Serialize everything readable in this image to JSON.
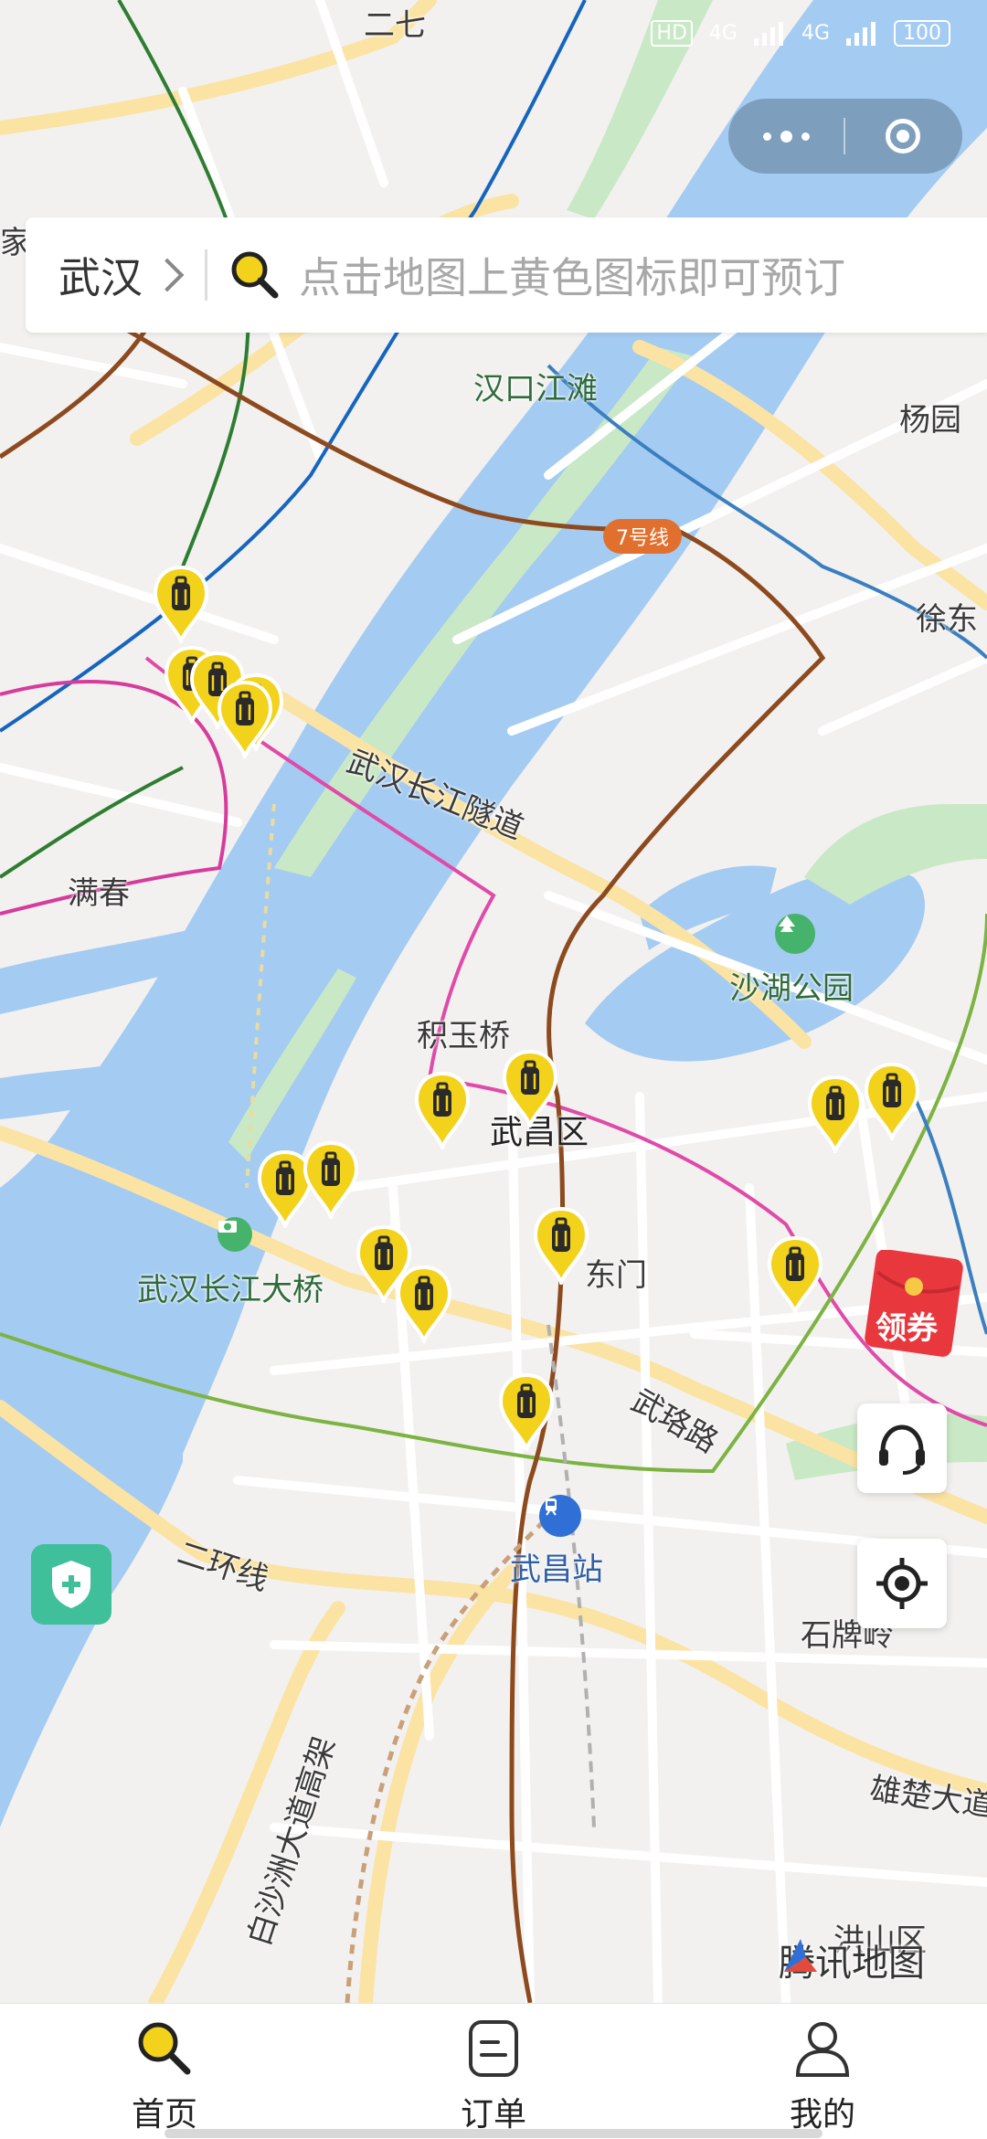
{
  "status_bar": {
    "network_badge": "HD",
    "signal_1": "4G",
    "signal_2": "4G",
    "battery": "100"
  },
  "search": {
    "city": "武汉",
    "placeholder": "点击地图上黄色图标即可预订"
  },
  "map": {
    "labels": {
      "erqi": "二七",
      "jia": "家",
      "hankou_jiangtan": "汉口江滩",
      "yangyuan": "杨园",
      "line7": "7号线",
      "xudong": "徐东",
      "tunnel": "武汉长江隧道",
      "manchun": "满春",
      "shahu_park": "沙湖公园",
      "jiyuqiao": "积玉桥",
      "wuchang_district": "武昌区",
      "bridge": "武汉长江大桥",
      "dongmen": "东门",
      "wuluo_road": "武珞路",
      "ring2": "二环线",
      "wuchang_station": "武昌站",
      "shipailing": "石牌岭",
      "baishazhou": "白沙洲大道高架",
      "xiongchu": "雄楚大道",
      "hongshan": "洪山区"
    },
    "provider": "腾讯地图",
    "pin_icon": "luggage-icon",
    "pin_color": "#f2d21b"
  },
  "coupon": {
    "label": "领券"
  },
  "tabs": [
    {
      "label": "首页",
      "icon": "search-icon"
    },
    {
      "label": "订单",
      "icon": "order-icon"
    },
    {
      "label": "我的",
      "icon": "user-icon"
    }
  ],
  "colors": {
    "water": "#a4cbf2",
    "park": "#c9e8c6",
    "land": "#f2f1ef",
    "road": "#ffffff",
    "major_road": "#fbe3a4",
    "accent": "#f2d21b"
  }
}
